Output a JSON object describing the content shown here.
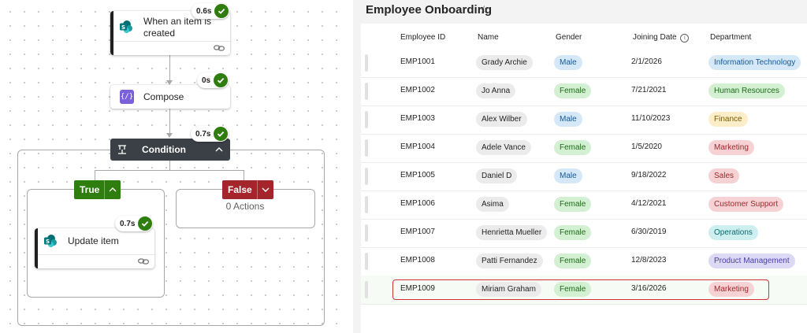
{
  "flow": {
    "trigger": {
      "title_line1": "When an item is",
      "title_line2": "created",
      "duration": "0.6s",
      "icon": "sharepoint-icon"
    },
    "compose": {
      "title": "Compose",
      "duration": "0s",
      "icon": "compose-icon"
    },
    "condition": {
      "title": "Condition",
      "duration": "0.7s"
    },
    "true_branch": {
      "label": "True"
    },
    "false_branch": {
      "label": "False",
      "empty_text": "0 Actions"
    },
    "update_item": {
      "title": "Update item",
      "duration": "0.7s",
      "icon": "sharepoint-icon"
    },
    "colors": {
      "success": "#2e7d0e",
      "true": "#2e7d0e",
      "false": "#a4262c",
      "condition": "#3b4046",
      "compose": "#7b61d9"
    }
  },
  "list": {
    "title": "Employee Onboarding",
    "favorite_icon": "star-icon",
    "columns": {
      "employee_id": "Employee ID",
      "name": "Name",
      "gender": "Gender",
      "joining_date": "Joining Date",
      "department": "Department"
    },
    "rows": [
      {
        "id": "EMP1001",
        "name": "Grady Archie",
        "gender": "Male",
        "date": "2/1/2026",
        "department": "Information Technology"
      },
      {
        "id": "EMP1002",
        "name": "Jo Anna",
        "gender": "Female",
        "date": "7/21/2021",
        "department": "Human Resources"
      },
      {
        "id": "EMP1003",
        "name": "Alex Wilber",
        "gender": "Male",
        "date": "11/10/2023",
        "department": "Finance"
      },
      {
        "id": "EMP1004",
        "name": "Adele Vance",
        "gender": "Female",
        "date": "1/5/2020",
        "department": "Marketing"
      },
      {
        "id": "EMP1005",
        "name": "Daniel D",
        "gender": "Male",
        "date": "9/18/2022",
        "department": "Sales"
      },
      {
        "id": "EMP1006",
        "name": "Asima",
        "gender": "Female",
        "date": "4/12/2021",
        "department": "Customer Support"
      },
      {
        "id": "EMP1007",
        "name": "Henrietta Mueller",
        "gender": "Female",
        "date": "6/30/2019",
        "department": "Operations"
      },
      {
        "id": "EMP1008",
        "name": "Patti Fernandez",
        "gender": "Female",
        "date": "12/8/2023",
        "department": "Product Management"
      },
      {
        "id": "EMP1009",
        "name": "Miriam Graham",
        "gender": "Female",
        "date": "3/16/2026",
        "department": "Marketing"
      }
    ],
    "department_colors": {
      "Information Technology": {
        "bg": "#d5e8f8",
        "fg": "#105a9c"
      },
      "Human Resources": {
        "bg": "#d4f0d2",
        "fg": "#1c6b1a"
      },
      "Finance": {
        "bg": "#fdeec9",
        "fg": "#7a5a00"
      },
      "Marketing": {
        "bg": "#f6d2d4",
        "fg": "#a4262c"
      },
      "Sales": {
        "bg": "#f6d2d4",
        "fg": "#a4262c"
      },
      "Customer Support": {
        "bg": "#f6d2d4",
        "fg": "#a4262c"
      },
      "Operations": {
        "bg": "#cdeff0",
        "fg": "#0b6a6e"
      },
      "Product Management": {
        "bg": "#dcd9f6",
        "fg": "#4b3fa6"
      }
    },
    "highlight_color": "#d13438"
  }
}
